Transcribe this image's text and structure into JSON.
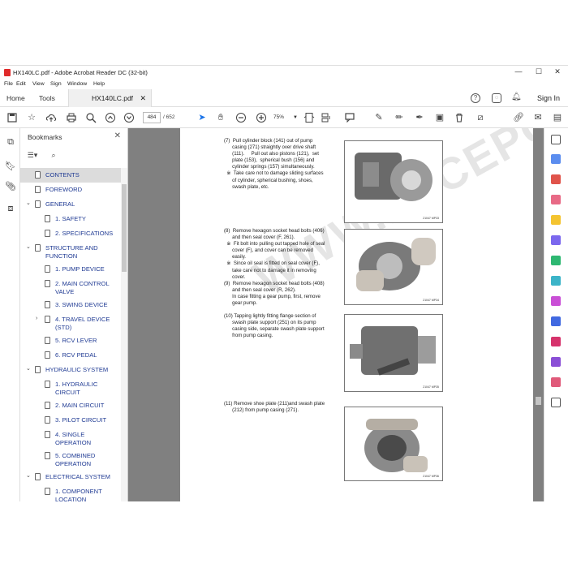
{
  "window": {
    "title": "HX140LC.pdf - Adobe Acrobat Reader DC (32-bit)",
    "minimize": "—",
    "maximize": "☐",
    "close": "✕"
  },
  "menu": [
    "File",
    "Edit",
    "View",
    "Sign",
    "Window",
    "Help"
  ],
  "tabs": {
    "home": "Home",
    "tools": "Tools",
    "document": "HX140LC.pdf",
    "sign_in": "Sign In",
    "help": "?"
  },
  "toolbar": {
    "page_current": "484",
    "page_total": "/  652",
    "zoom": "75%"
  },
  "bookmarks": {
    "title": "Bookmarks",
    "items": [
      {
        "label": "CONTENTS",
        "level": 0,
        "expander": ""
      },
      {
        "label": "FOREWORD",
        "level": 0,
        "expander": ""
      },
      {
        "label": "GENERAL",
        "level": 0,
        "expander": "⌄"
      },
      {
        "label": "1. SAFETY",
        "level": 1,
        "expander": ""
      },
      {
        "label": "2. SPECIFICATIONS",
        "level": 1,
        "expander": ""
      },
      {
        "label": "STRUCTURE AND",
        "label2": "FUNCTION",
        "level": 0,
        "expander": "⌄"
      },
      {
        "label": "1. PUMP DEVICE",
        "level": 1,
        "expander": ""
      },
      {
        "label": "2. MAIN CONTROL",
        "label2": "VALVE",
        "level": 1,
        "expander": ""
      },
      {
        "label": "3. SWING DEVICE",
        "level": 1,
        "expander": ""
      },
      {
        "label": "4. TRAVEL DEVICE",
        "label2": "(STD)",
        "level": 1,
        "expander": "›"
      },
      {
        "label": "5. RCV LEVER",
        "level": 1,
        "expander": ""
      },
      {
        "label": "6. RCV PEDAL",
        "level": 1,
        "expander": ""
      },
      {
        "label": "HYDRAULIC SYSTEM",
        "level": 0,
        "expander": "⌄"
      },
      {
        "label": "1. HYDRAULIC",
        "label2": "CIRCUIT",
        "level": 1,
        "expander": ""
      },
      {
        "label": "2. MAIN CIRCUIT",
        "level": 1,
        "expander": ""
      },
      {
        "label": "3. PILOT CIRCUIT",
        "level": 1,
        "expander": ""
      },
      {
        "label": "4. SINGLE",
        "label2": "OPERATION",
        "level": 1,
        "expander": ""
      },
      {
        "label": "5. COMBINED",
        "label2": "OPERATION",
        "level": 1,
        "expander": ""
      },
      {
        "label": "ELECTRICAL SYSTEM",
        "level": 0,
        "expander": "⌄"
      },
      {
        "label": "1. COMPONENT",
        "label2": "LOCATION",
        "level": 1,
        "expander": ""
      }
    ]
  },
  "document": {
    "watermark": "WWW.EPCEPO.COM",
    "steps": [
      {
        "lines": [
          "(7)  Pull cylinder block (141) out of pump",
          "      casing (271) straightly over drive shaft",
          "      (111).     Pull out also pistons (121),  set",
          "      plate (153),  spherical bush (156) and",
          "      cylinder springs (157) simultaneously.",
          "  ※  Take care not to damage sliding surfaces",
          "      of cylinder, spherical bushing, shoes,",
          "      swash plate, etc."
        ],
        "figure_caption": "21047 MP33"
      },
      {
        "lines": [
          "(8)  Remove hexagon socket head bolts (406)",
          "      and then seal cover (F, 261).",
          "  ※  Fit bolt into pulling out tapped hole of seal",
          "      cover (F), and cover can be removed",
          "      easily.",
          "  ※  Since oil seal is fitted on seal cover (F),",
          "      take care not to damage it in removing",
          "      cover.",
          "(9)  Remove hexagon socket head bolts (408)",
          "      and then seal cover (R, 262).",
          "      In case fitting a gear pump, first, remove",
          "      gear pump."
        ],
        "figure_caption": "21047 MP34"
      },
      {
        "lines": [
          "(10) Tapping lightly fitting flange section of",
          "      swash plate support (251) on its pump",
          "      casing side, separate swash plate support",
          "      from pump casing."
        ],
        "figure_caption": "21047 MP35"
      },
      {
        "lines": [
          "(11) Remove shoe plate (211)and swash plate",
          "      (212) from pump casing (271)."
        ],
        "figure_caption": "21047 MP36"
      }
    ]
  },
  "colors": {
    "bookmark_text": "#1f3a93",
    "viewer_bg": "#808080",
    "selected_bg": "#dcdcdc",
    "pdf_red": "#e02b2b"
  }
}
